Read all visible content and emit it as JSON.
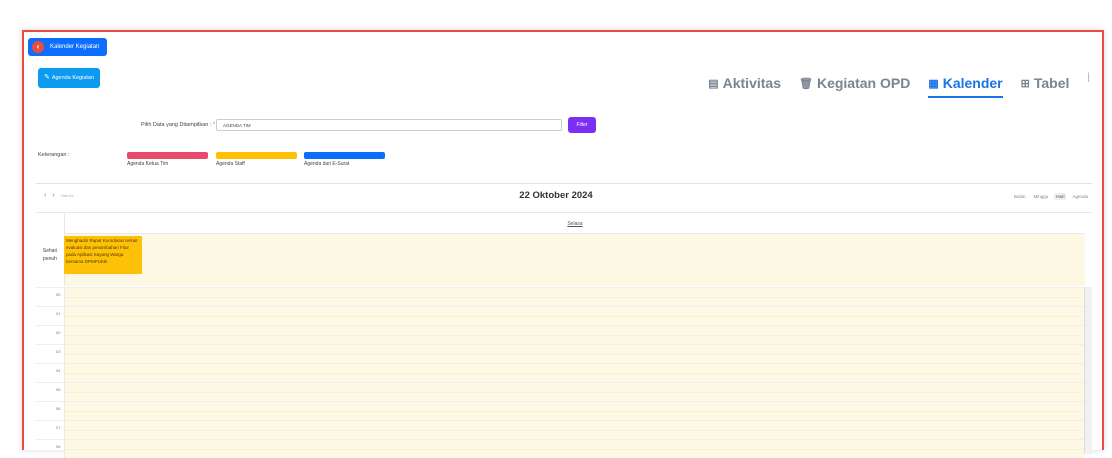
{
  "header": {
    "title": "Kalender Kegiatan",
    "icon": "back-arrow-icon"
  },
  "toolbar": {
    "add_label": "Agenda Kegiatan",
    "add_icon": "pencil-icon"
  },
  "tabs": [
    {
      "label": "Aktivitas",
      "icon": "list-icon",
      "active": false
    },
    {
      "label": "Kegiatan OPD",
      "icon": "trash-icon",
      "active": false
    },
    {
      "label": "Kalender",
      "icon": "calendar-icon",
      "active": true
    },
    {
      "label": "Tabel",
      "icon": "table-icon",
      "active": false
    }
  ],
  "filter": {
    "label": "Pilih Data yang Ditampilkan :",
    "required_mark": "*",
    "value": "AGENDA TIM",
    "button": "Filter"
  },
  "legend": {
    "label": "Keterangan :",
    "items": [
      {
        "label": "Agenda Ketua Tim",
        "color": "#e84a6b"
      },
      {
        "label": "Agenda Staff",
        "color": "#ffc107"
      },
      {
        "label": "Agenda dari E-Surat",
        "color": "#0d6efd"
      }
    ]
  },
  "calendar": {
    "prev": "‹",
    "next": "›",
    "today": "Hari Ini",
    "title": "22 Oktober 2024",
    "views": [
      "Bulan",
      "Minggu",
      "Hari",
      "Agenda"
    ],
    "active_view": "Hari",
    "day_header": "Selasa",
    "allday_label": "Sehari penuh",
    "event": {
      "text": "Menghadiri Rapat Koordinasi terkait evaluasi dan penambahan Fitur pada Aplikasi Sayang Warga bersama DPMPUKB",
      "color": "#ffc107"
    },
    "hours": [
      "00",
      "01",
      "02",
      "03",
      "04",
      "05",
      "06",
      "07",
      "08"
    ]
  }
}
